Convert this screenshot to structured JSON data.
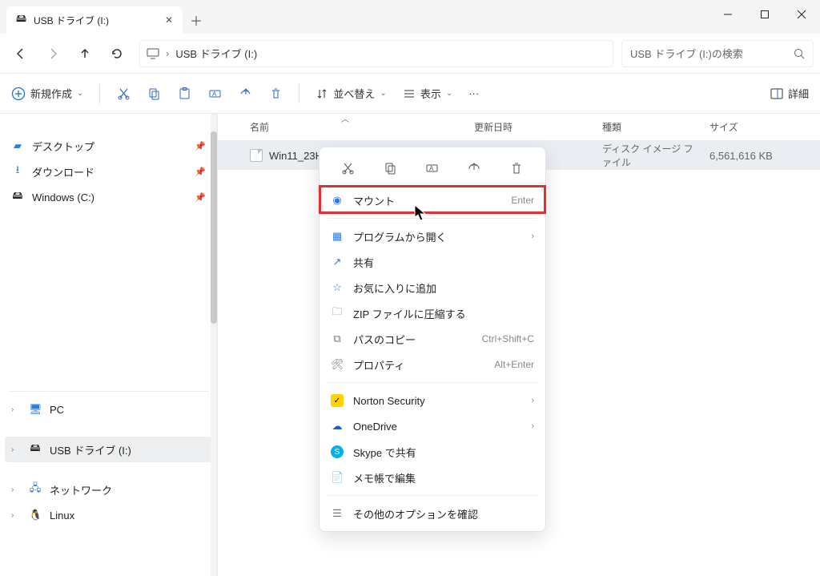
{
  "window": {
    "tab_title": "USB ドライブ (I:)",
    "address_label": "USB ドライブ (I:)",
    "search_placeholder": "USB ドライブ (I:)の検索"
  },
  "toolbar": {
    "new": "新規作成",
    "sort": "並べ替え",
    "view": "表示",
    "details": "詳細"
  },
  "columns": {
    "name": "名前",
    "date": "更新日時",
    "type": "種類",
    "size": "サイズ"
  },
  "sidebar": {
    "quick": [
      {
        "label": "デスクトップ",
        "icon": "🟦",
        "pinned": true
      },
      {
        "label": "ダウンロード",
        "icon": "⭳",
        "pinned": true
      },
      {
        "label": "Windows (C:)",
        "icon": "🖴",
        "pinned": true
      }
    ],
    "pc": "PC",
    "usb": "USB ドライブ (I:)",
    "network": "ネットワーク",
    "linux": "Linux"
  },
  "file": {
    "name": "Win11_23H2_J",
    "type": "ディスク イメージ ファイル",
    "size": "6,561,616 KB"
  },
  "context_menu": {
    "mount": {
      "label": "マウント",
      "shortcut": "Enter"
    },
    "open_with": "プログラムから開く",
    "share": "共有",
    "favorite": "お気に入りに追加",
    "zip": "ZIP ファイルに圧縮する",
    "copy_path": {
      "label": "パスのコピー",
      "shortcut": "Ctrl+Shift+C"
    },
    "properties": {
      "label": "プロパティ",
      "shortcut": "Alt+Enter"
    },
    "norton": "Norton Security",
    "onedrive": "OneDrive",
    "skype": "Skype で共有",
    "notepad": "メモ帳で編集",
    "more": "その他のオプションを確認"
  }
}
